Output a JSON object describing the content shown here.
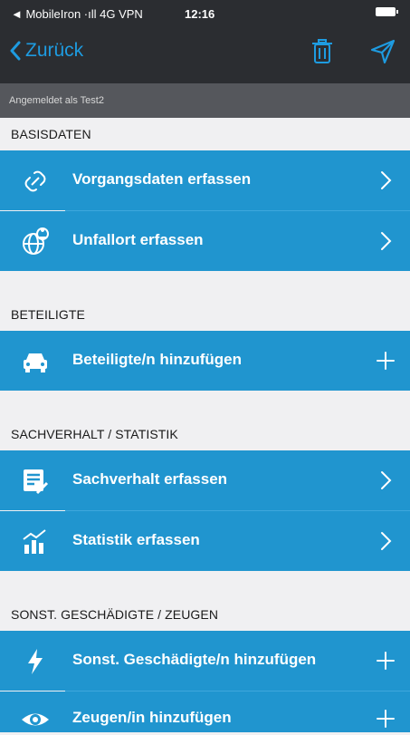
{
  "status": {
    "carrier": "◄ MobileIron ·ıll 4G VPN",
    "time": "12:16"
  },
  "nav": {
    "back_label": "Zurück"
  },
  "login": {
    "text": "Angemeldet als Test2"
  },
  "sections": [
    {
      "title": "BASISDATEN"
    },
    {
      "title": "BETEILIGTE"
    },
    {
      "title": "SACHVERHALT / STATISTIK"
    },
    {
      "title": "SONST. GESCHÄDIGTE / ZEUGEN"
    }
  ],
  "rows": [
    {
      "label": "Vorgangsdaten erfassen",
      "icon": "link-icon",
      "accessory": "chevron"
    },
    {
      "label": "Unfallort erfassen",
      "icon": "globe-pin-icon",
      "accessory": "chevron"
    },
    {
      "label": "Beteiligte/n hinzufügen",
      "icon": "car-icon",
      "accessory": "plus"
    },
    {
      "label": "Sachverhalt erfassen",
      "icon": "document-edit-icon",
      "accessory": "chevron"
    },
    {
      "label": "Statistik erfassen",
      "icon": "statistics-icon",
      "accessory": "chevron"
    },
    {
      "label": "Sonst. Geschädigte/n hinzufügen",
      "icon": "lightning-icon",
      "accessory": "plus"
    },
    {
      "label": "Zeugen/in hinzufügen",
      "icon": "eye-icon",
      "accessory": "plus"
    }
  ],
  "colors": {
    "accent": "#1e9be0",
    "row_bg": "#2095cf",
    "nav_bg": "#2b2d31",
    "login_bg": "#55575c"
  }
}
